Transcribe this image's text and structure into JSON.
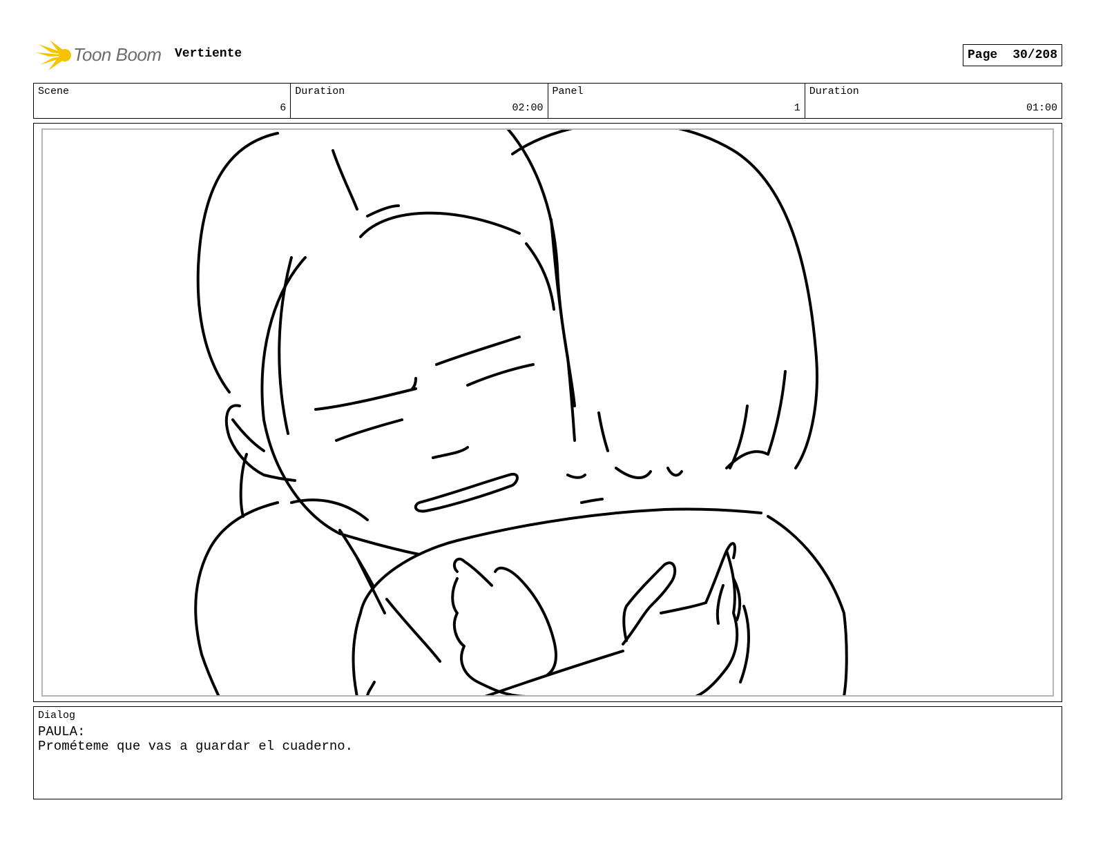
{
  "header": {
    "logo_text": "Toon Boom",
    "project_title": "Vertiente",
    "page_label": "Page",
    "page_number": "30/208"
  },
  "info": {
    "scene_label": "Scene",
    "scene_value": "6",
    "scene_duration_label": "Duration",
    "scene_duration_value": "02:00",
    "panel_label": "Panel",
    "panel_value": "1",
    "panel_duration_label": "Duration",
    "panel_duration_value": "01:00"
  },
  "panel": {
    "drawing_icon": "storyboard-sketch"
  },
  "dialog": {
    "label": "Dialog",
    "speaker": "PAULA:",
    "line": "Prométeme que vas a guardar el cuaderno."
  },
  "colors": {
    "logo_yellow": "#f5c400",
    "logo_text": "#6d6d6d",
    "frame_grey": "#b4b4b4"
  }
}
